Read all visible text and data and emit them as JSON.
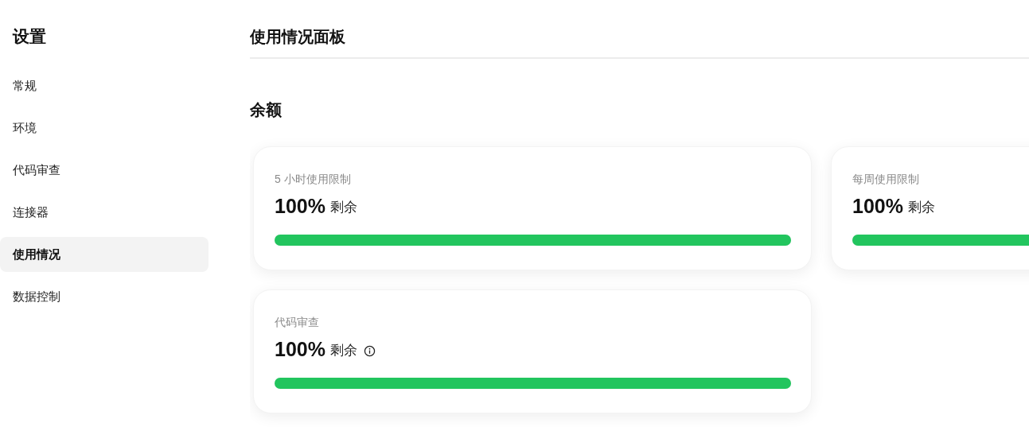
{
  "sidebar": {
    "title": "设置",
    "items": [
      {
        "label": "常规",
        "selected": false
      },
      {
        "label": "环境",
        "selected": false
      },
      {
        "label": "代码审查",
        "selected": false
      },
      {
        "label": "连接器",
        "selected": false
      },
      {
        "label": "使用情况",
        "selected": true
      },
      {
        "label": "数据控制",
        "selected": false
      }
    ]
  },
  "header": {
    "title": "使用情况面板"
  },
  "section": {
    "title": "余额",
    "cards": [
      {
        "label": "5 小时使用限制",
        "value": "100%",
        "suffix": "剩余",
        "info": false,
        "level": 1
      },
      {
        "label": "每周使用限制",
        "value": "100%",
        "suffix": "剩余",
        "info": false,
        "level": 1
      },
      {
        "label": "代码审查",
        "value": "100%",
        "suffix": "剩余",
        "info": true,
        "level": 1
      }
    ]
  }
}
